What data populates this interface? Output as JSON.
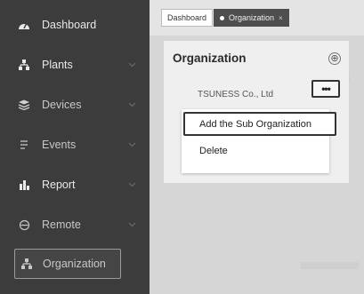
{
  "sidebar": {
    "items": [
      {
        "label": "Dashboard",
        "icon": "dashboard-gauge-icon",
        "has_chevron": false
      },
      {
        "label": "Plants",
        "icon": "plant-tree-icon",
        "has_chevron": true
      },
      {
        "label": "Devices",
        "icon": "devices-stack-icon",
        "has_chevron": true
      },
      {
        "label": "Events",
        "icon": "events-list-icon",
        "has_chevron": true
      },
      {
        "label": "Report",
        "icon": "report-bar-chart-icon",
        "has_chevron": true
      },
      {
        "label": "Remote",
        "icon": "remote-target-icon",
        "has_chevron": true
      },
      {
        "label": "Organization",
        "icon": "organization-tree-icon",
        "has_chevron": false
      }
    ]
  },
  "tabs": {
    "dashboard": "Dashboard",
    "organization": "Organization",
    "close_glyph": "×"
  },
  "panel": {
    "title": "Organization",
    "add_glyph": "⊕",
    "org_name": "TSUNESS Co., Ltd",
    "more_glyph": "•••"
  },
  "menu": {
    "add_sub": "Add the Sub Organization",
    "delete": "Delete"
  },
  "colors": {
    "sidebar_bg": "#3c3c3c",
    "content_bg": "#d6d6d6",
    "panel_bg": "#efefef",
    "active_tab_bg": "#4e4e4e"
  }
}
